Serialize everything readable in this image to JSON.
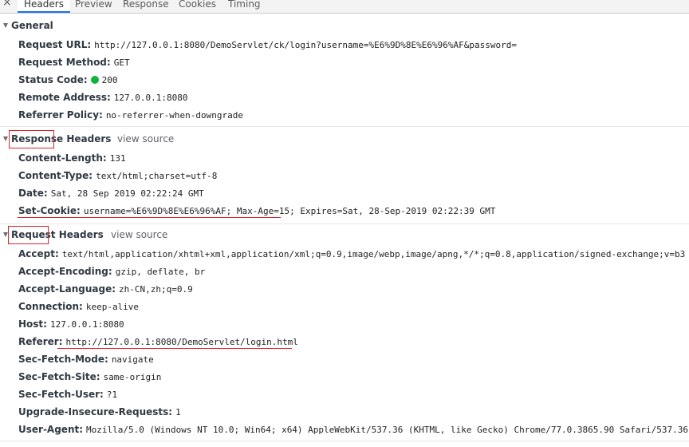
{
  "tabs": {
    "close_icon": "×",
    "items": [
      {
        "label": "Headers",
        "active": true
      },
      {
        "label": "Preview"
      },
      {
        "label": "Response"
      },
      {
        "label": "Cookies"
      },
      {
        "label": "Timing"
      }
    ]
  },
  "general": {
    "title": "General",
    "rows": [
      {
        "key": "Request URL:",
        "value": "http://127.0.0.1:8080/DemoServlet/ck/login?username=%E6%9D%8E%E6%96%AF&password="
      },
      {
        "key": "Request Method:",
        "value": "GET"
      },
      {
        "key": "Status Code:",
        "value": "200",
        "status_color": "#0cb43b"
      },
      {
        "key": "Remote Address:",
        "value": "127.0.0.1:8080"
      },
      {
        "key": "Referrer Policy:",
        "value": "no-referrer-when-downgrade"
      }
    ]
  },
  "response_headers": {
    "title_boxed": "Response",
    "title_rest": " Headers",
    "view_source": "view source",
    "rows": [
      {
        "key": "Content-Length:",
        "value": "131"
      },
      {
        "key": "Content-Type:",
        "value": "text/html;charset=utf-8"
      },
      {
        "key": "Date:",
        "value": "Sat, 28 Sep 2019 02:22:24 GMT"
      },
      {
        "key": "Set-Cookie:",
        "value": "username=%E6%9D%8E%E6%96%AF; Max-Age=15; Expires=Sat, 28-Sep-2019 02:22:39 GMT"
      }
    ]
  },
  "request_headers": {
    "title_boxed": "Request",
    "title_rest": " Headers",
    "view_source": "view source",
    "rows": [
      {
        "key": "Accept:",
        "value": "text/html,application/xhtml+xml,application/xml;q=0.9,image/webp,image/apng,*/*;q=0.8,application/signed-exchange;v=b3"
      },
      {
        "key": "Accept-Encoding:",
        "value": "gzip, deflate, br"
      },
      {
        "key": "Accept-Language:",
        "value": "zh-CN,zh;q=0.9"
      },
      {
        "key": "Connection:",
        "value": "keep-alive"
      },
      {
        "key": "Host:",
        "value": "127.0.0.1:8080"
      },
      {
        "key": "Referer:",
        "value": "http://127.0.0.1:8080/DemoServlet/login.html"
      },
      {
        "key": "Sec-Fetch-Mode:",
        "value": "navigate"
      },
      {
        "key": "Sec-Fetch-Site:",
        "value": "same-origin"
      },
      {
        "key": "Sec-Fetch-User:",
        "value": "?1"
      },
      {
        "key": "Upgrade-Insecure-Requests:",
        "value": "1"
      },
      {
        "key": "User-Agent:",
        "value": "Mozilla/5.0 (Windows NT 10.0; Win64; x64) AppleWebKit/537.36 (KHTML, like Gecko) Chrome/77.0.3865.90 Safari/537.36"
      }
    ]
  },
  "colors": {
    "annotation_red": "#d9232b",
    "status_green": "#0cb43b"
  }
}
